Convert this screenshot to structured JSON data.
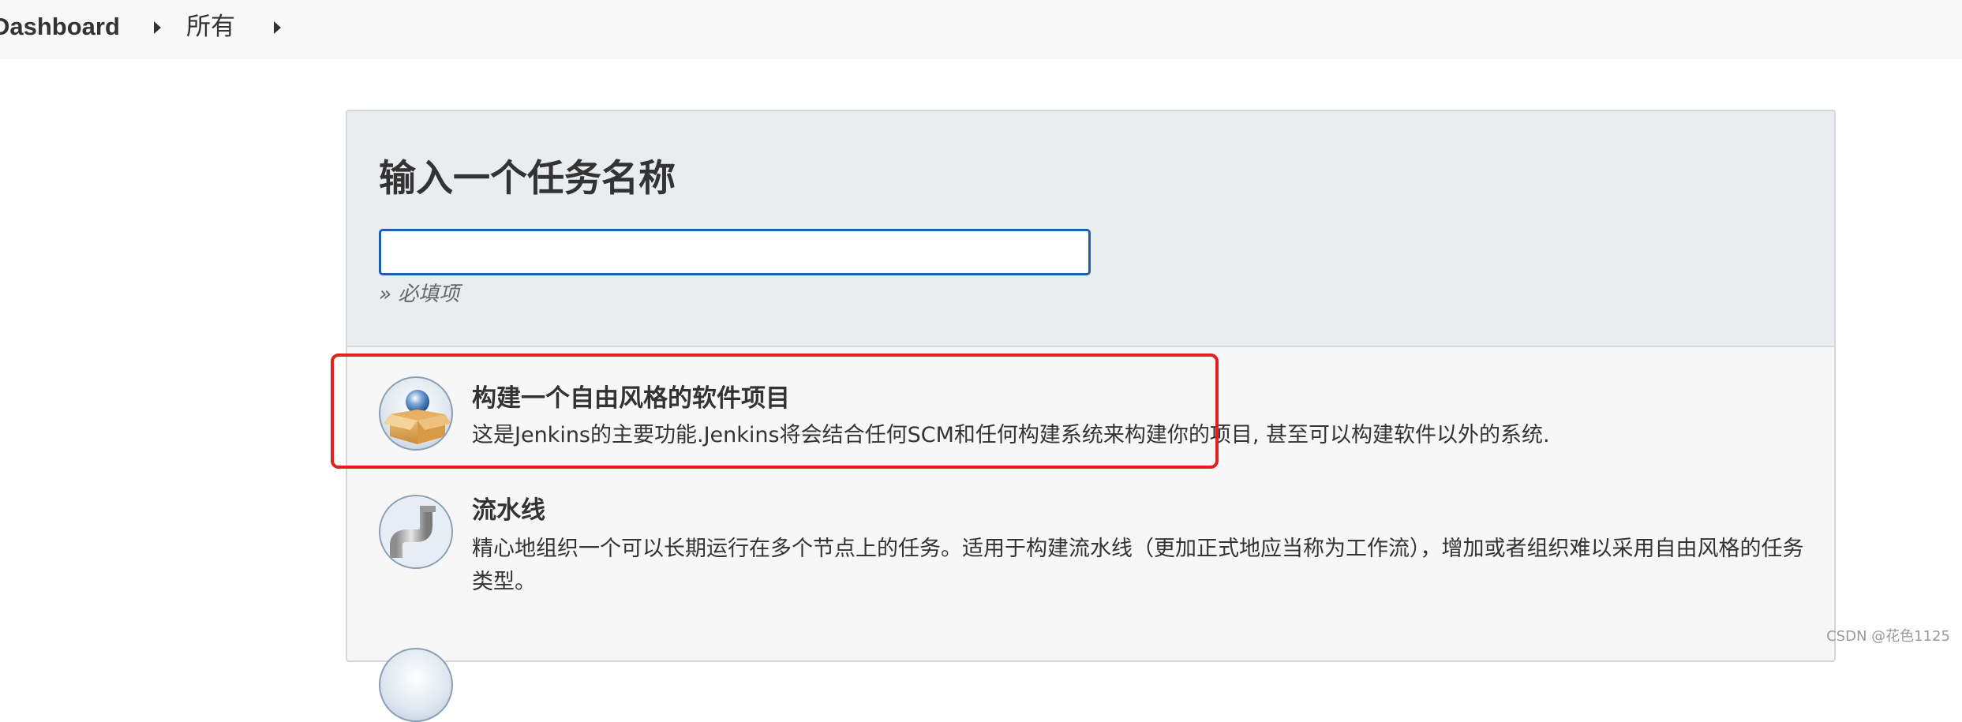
{
  "breadcrumb": {
    "items": [
      "Dashboard",
      "所有"
    ]
  },
  "panel": {
    "title": "输入一个任务名称",
    "name_input": {
      "value": "",
      "placeholder": ""
    },
    "required_hint": "» 必填项"
  },
  "job_types": [
    {
      "title": "构建一个自由风格的软件项目",
      "description": "这是Jenkins的主要功能.Jenkins将会结合任何SCM和任何构建系统来构建你的项目, 甚至可以构建软件以外的系统.",
      "icon": "freestyle-package-icon"
    },
    {
      "title": "流水线",
      "description": "精心地组织一个可以长期运行在多个节点上的任务。适用于构建流水线（更加正式地应当称为工作流），增加或者组织难以采用自由风格的任务类型。",
      "icon": "pipeline-icon"
    }
  ],
  "colors": {
    "input_border": "#1f5ea8",
    "highlight": "#e0211d",
    "header_bg": "#eaedf0"
  },
  "watermark": "CSDN @花色1125"
}
